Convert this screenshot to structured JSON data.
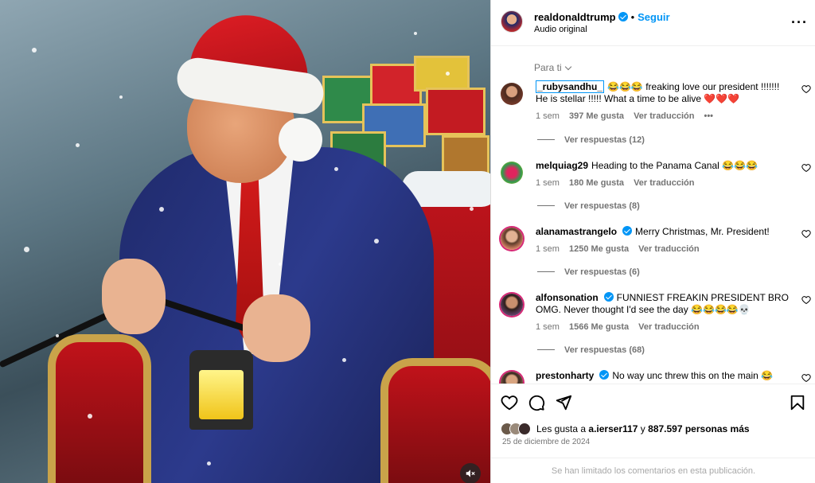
{
  "post": {
    "username": "realdonaldtrump",
    "follow_label": "Seguir",
    "audio": "Audio original",
    "sort_label": "Para ti"
  },
  "comments": [
    {
      "username": "_rubysandhu_",
      "text": "😂😂😂 freaking love our president !!!!!!! He is stellar !!!!! What a time to be alive ❤️❤️❤️",
      "time": "1 sem",
      "likes": "397 Me gusta",
      "translate": "Ver traducción",
      "more": "•••",
      "replies": "Ver respuestas (12)",
      "verified": false
    },
    {
      "username": "melquiag29",
      "text": "Heading to the Panama Canal 😂😂😂",
      "time": "1 sem",
      "likes": "180 Me gusta",
      "translate": "Ver traducción",
      "replies": "Ver respuestas (8)",
      "verified": false
    },
    {
      "username": "alanamastrangelo",
      "text": "Merry Christmas, Mr. President!",
      "time": "1 sem",
      "likes": "1250 Me gusta",
      "translate": "Ver traducción",
      "replies": "Ver respuestas (6)",
      "verified": true
    },
    {
      "username": "alfonsonation",
      "text": "FUNNIEST FREAKIN PRESIDENT BRO OMG. Never thought I'd see the day 😂😂😂😂💀",
      "time": "1 sem",
      "likes": "1566 Me gusta",
      "translate": "Ver traducción",
      "replies": "Ver respuestas (68)",
      "verified": true
    },
    {
      "username": "prestonharty",
      "text": "No way unc threw this on the main 😂",
      "verified": true
    }
  ],
  "likes": {
    "prefix": "Les gusta a",
    "user": "a.ierser117",
    "middle": "y",
    "count": "887.597 personas más"
  },
  "date": "25 de diciembre de 2024",
  "limited_notice": "Se han limitado los comentarios en esta publicación.",
  "icons": [
    "verified-badge",
    "more-options-icon",
    "heart-icon",
    "comment-icon",
    "share-icon",
    "bookmark-icon",
    "mute-icon",
    "chevron-down-icon"
  ],
  "colors": {
    "accent": "#0095f6",
    "secondary_text": "#737373"
  }
}
